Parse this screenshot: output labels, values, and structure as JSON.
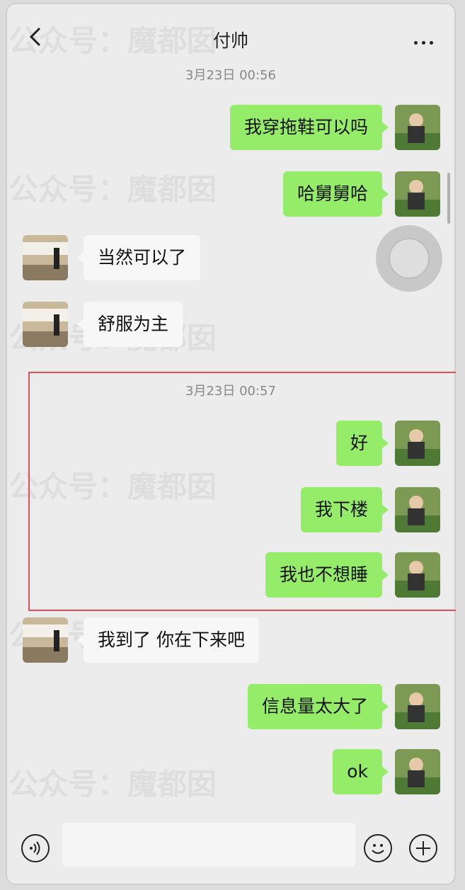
{
  "header": {
    "title": "付帅"
  },
  "watermark": "公众号：魔都囡",
  "messages": {
    "ts1": "3月23日 00:56",
    "m1": "我穿拖鞋可以吗",
    "m2": "哈舅舅哈",
    "m3": "当然可以了",
    "m4": "舒服为主",
    "ts2": "3月23日 00:57",
    "m5": "好",
    "m6": "我下楼",
    "m7": "我也不想睡",
    "m8": "我到了 你在下来吧",
    "m9": "信息量太大了",
    "m10": "ok"
  },
  "colors": {
    "my_bubble": "#95ec69",
    "other_bubble": "#f7f7f7",
    "highlight_border": "#e0505a",
    "background": "#ececec"
  },
  "icons": [
    "back-arrow-icon",
    "more-dots-icon",
    "voice-icon",
    "emoji-icon",
    "plus-icon"
  ]
}
